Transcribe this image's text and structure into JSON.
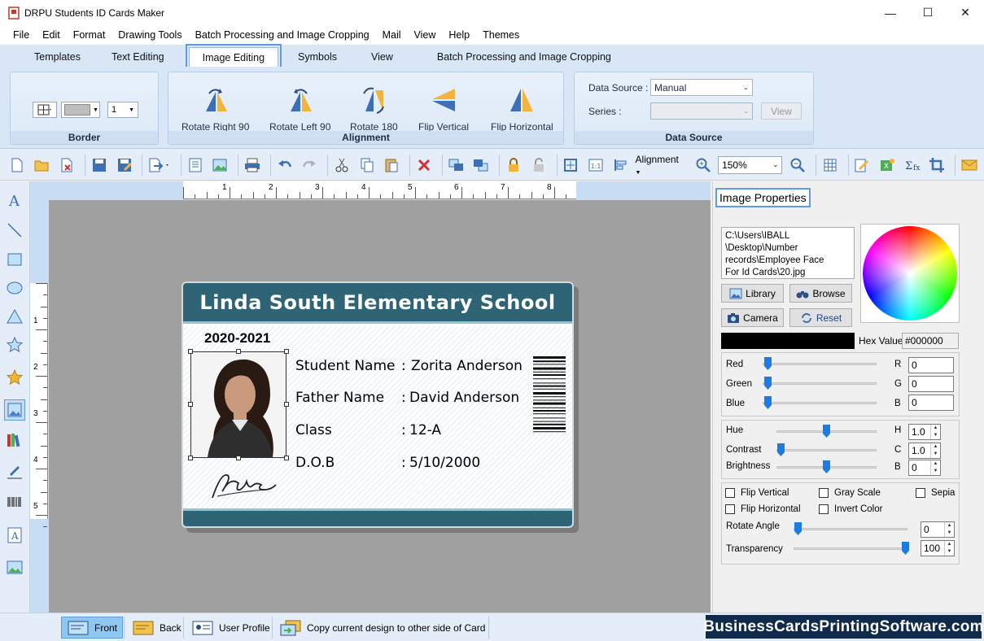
{
  "window": {
    "title": "DRPU Students ID Cards Maker"
  },
  "menu": [
    "File",
    "Edit",
    "Format",
    "Drawing Tools",
    "Batch Processing and Image Cropping",
    "Mail",
    "View",
    "Help",
    "Themes"
  ],
  "ribbon_tabs": [
    "Templates",
    "Text Editing",
    "Image Editing",
    "Symbols",
    "View",
    "Batch Processing and Image Cropping"
  ],
  "border_group": {
    "label": "Border",
    "width_value": "1"
  },
  "alignment_group": {
    "label": "Alignment",
    "buttons": [
      "Rotate Right 90",
      "Rotate Left 90",
      "Rotate 180",
      "Flip Vertical",
      "Flip Horizontal"
    ]
  },
  "data_source_group": {
    "label": "Data Source",
    "source_label": "Data Source :",
    "source_value": "Manual",
    "series_label": "Series :",
    "series_value": "",
    "view_button": "View"
  },
  "toolbar": {
    "alignment_label": "Alignment",
    "zoom_value": "150%"
  },
  "ruler": {
    "top": [
      "1",
      "2",
      "3",
      "4",
      "5",
      "6",
      "7",
      "8"
    ],
    "left": [
      "1",
      "2",
      "3",
      "4",
      "5"
    ]
  },
  "card": {
    "school": "Linda South  Elementary School",
    "year": "2020-2021",
    "fields": [
      {
        "label": "Student Name",
        "value": "Zorita Anderson"
      },
      {
        "label": "Father Name",
        "value": "David Anderson"
      },
      {
        "label": "Class",
        "value": "12-A"
      },
      {
        "label": "D.O.B",
        "value": "5/10/2000"
      }
    ],
    "header_color": "#2e6475"
  },
  "image_properties": {
    "title": "Image Properties",
    "path_lines": [
      "C:\\Users\\IBALL",
      "\\Desktop\\Number",
      "records\\Employee Face",
      "For Id Cards\\20.jpg"
    ],
    "buttons": {
      "library": "Library",
      "browse": "Browse",
      "camera": "Camera",
      "reset": "Reset"
    },
    "hex_label": "Hex Value",
    "hex_value": "#000000",
    "rgb": [
      {
        "label": "Red",
        "short": "R",
        "value": "0"
      },
      {
        "label": "Green",
        "short": "G",
        "value": "0"
      },
      {
        "label": "Blue",
        "short": "B",
        "value": "0"
      }
    ],
    "adjust": [
      {
        "label": "Hue",
        "short": "H",
        "value": "1.0"
      },
      {
        "label": "Contrast",
        "short": "C",
        "value": "1.0"
      },
      {
        "label": "Brightness",
        "short": "B",
        "value": "0"
      }
    ],
    "checkboxes": [
      "Flip Vertical",
      "Gray Scale",
      "Sepia",
      "Flip Horizontal",
      "Invert Color"
    ],
    "rotate_label": "Rotate Angle",
    "rotate_value": "0",
    "transparency_label": "Transparency",
    "transparency_value": "100"
  },
  "status": {
    "front": "Front",
    "back": "Back",
    "user_profile": "User Profile",
    "copy": "Copy current design to other side of Card",
    "brand": "BusinessCardsPrintingSoftware.com"
  }
}
